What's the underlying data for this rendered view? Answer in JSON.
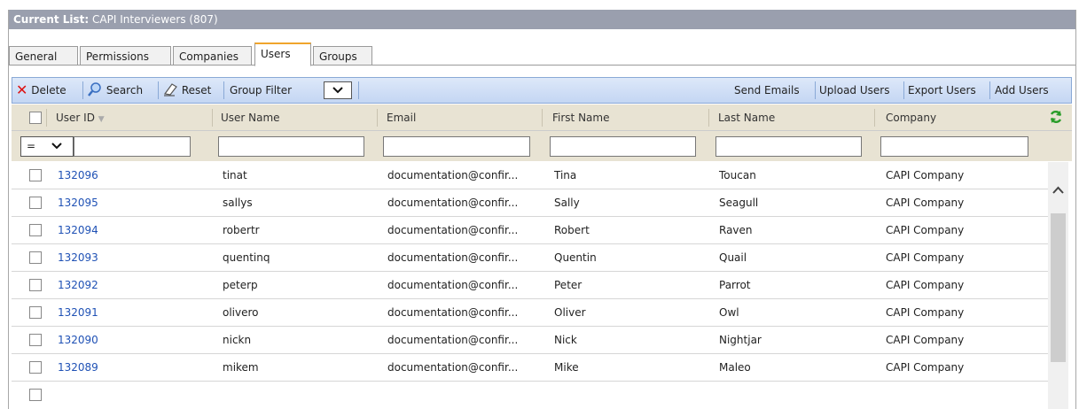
{
  "title": {
    "label": "Current List:",
    "value": "CAPI Interviewers (807)"
  },
  "tabs": [
    {
      "label": "General"
    },
    {
      "label": "Permissions"
    },
    {
      "label": "Companies"
    },
    {
      "label": "Users",
      "active": true
    },
    {
      "label": "Groups"
    }
  ],
  "toolbar": {
    "delete": "Delete",
    "search": "Search",
    "reset": "Reset",
    "group_filter": "Group Filter",
    "send_emails": "Send Emails",
    "upload_users": "Upload Users",
    "export_users": "Export Users",
    "add_users": "Add Users"
  },
  "columns": [
    "User ID",
    "User Name",
    "Email",
    "First Name",
    "Last Name",
    "Company"
  ],
  "filter": {
    "operator": "="
  },
  "rows": [
    {
      "id": "132096",
      "username": "tinat",
      "email": "documentation@confir...",
      "first": "Tina",
      "last": "Toucan",
      "company": "CAPI Company"
    },
    {
      "id": "132095",
      "username": "sallys",
      "email": "documentation@confir...",
      "first": "Sally",
      "last": "Seagull",
      "company": "CAPI Company"
    },
    {
      "id": "132094",
      "username": "robertr",
      "email": "documentation@confir...",
      "first": "Robert",
      "last": "Raven",
      "company": "CAPI Company"
    },
    {
      "id": "132093",
      "username": "quentinq",
      "email": "documentation@confir...",
      "first": "Quentin",
      "last": "Quail",
      "company": "CAPI Company"
    },
    {
      "id": "132092",
      "username": "peterp",
      "email": "documentation@confir...",
      "first": "Peter",
      "last": "Parrot",
      "company": "CAPI Company"
    },
    {
      "id": "132091",
      "username": "olivero",
      "email": "documentation@confir...",
      "first": "Oliver",
      "last": "Owl",
      "company": "CAPI Company"
    },
    {
      "id": "132090",
      "username": "nickn",
      "email": "documentation@confir...",
      "first": "Nick",
      "last": "Nightjar",
      "company": "CAPI Company"
    },
    {
      "id": "132089",
      "username": "mikem",
      "email": "documentation@confir...",
      "first": "Mike",
      "last": "Maleo",
      "company": "CAPI Company"
    }
  ],
  "colors": {
    "title_bar": "#9a9fae",
    "toolbar": "#c4d6f3",
    "header": "#e8e3d3",
    "link": "#1f51b5",
    "active_tab": "#f0a52c",
    "delete_icon": "#d11",
    "refresh_icon": "#2a9d2a"
  }
}
